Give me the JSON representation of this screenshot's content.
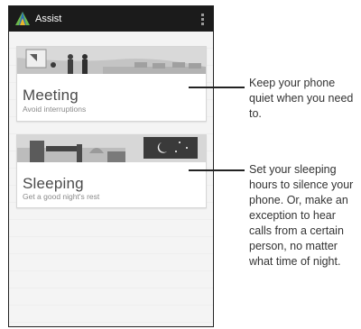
{
  "app": {
    "title": "Assist"
  },
  "cards": [
    {
      "title": "Meeting",
      "subtitle": "Avoid interruptions"
    },
    {
      "title": "Sleeping",
      "subtitle": "Get a good night's rest"
    }
  ],
  "callouts": [
    {
      "text": "Keep your phone quiet when you need to."
    },
    {
      "text": "Set your sleeping hours to silence your phone. Or, make an exception to hear calls from a certain person, no matter what time of night."
    }
  ],
  "colors": {
    "appbar": "#1b1b1b",
    "icon_green": "#6bb84b",
    "icon_blue": "#2a6fb6",
    "icon_yellow": "#e9b72a"
  },
  "icons": [
    "assist-app-icon",
    "overflow-menu-icon"
  ]
}
